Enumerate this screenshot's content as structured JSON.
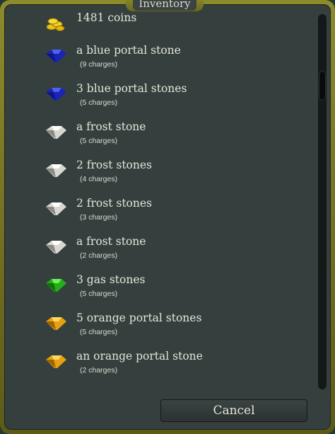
{
  "window": {
    "title": "Inventory"
  },
  "items": [
    {
      "name": "1481 coins",
      "sub": "",
      "icon": "coins-icon",
      "color": "#e8c21a"
    },
    {
      "name": "a blue portal stone",
      "sub": "(9 charges)",
      "icon": "blue-gem-icon",
      "color": "#2030c8"
    },
    {
      "name": "3 blue portal stones",
      "sub": "(5 charges)",
      "icon": "blue-gem-icon",
      "color": "#2030c8"
    },
    {
      "name": "a frost stone",
      "sub": "(5 charges)",
      "icon": "white-gem-icon",
      "color": "#e8e8e8"
    },
    {
      "name": "2 frost stones",
      "sub": "(4 charges)",
      "icon": "white-gem-icon",
      "color": "#e8e8e8"
    },
    {
      "name": "2 frost stones",
      "sub": "(3 charges)",
      "icon": "white-gem-icon",
      "color": "#e8e8e8"
    },
    {
      "name": "a frost stone",
      "sub": "(2 charges)",
      "icon": "white-gem-icon",
      "color": "#e8e8e8"
    },
    {
      "name": "3 gas stones",
      "sub": "(5 charges)",
      "icon": "green-gem-icon",
      "color": "#2ec41e"
    },
    {
      "name": "5 orange portal stones",
      "sub": "(5 charges)",
      "icon": "orange-gem-icon",
      "color": "#f0b018"
    },
    {
      "name": "an orange portal stone",
      "sub": "(2 charges)",
      "icon": "orange-gem-icon",
      "color": "#f0b018"
    }
  ],
  "buttons": {
    "cancel": "Cancel"
  }
}
